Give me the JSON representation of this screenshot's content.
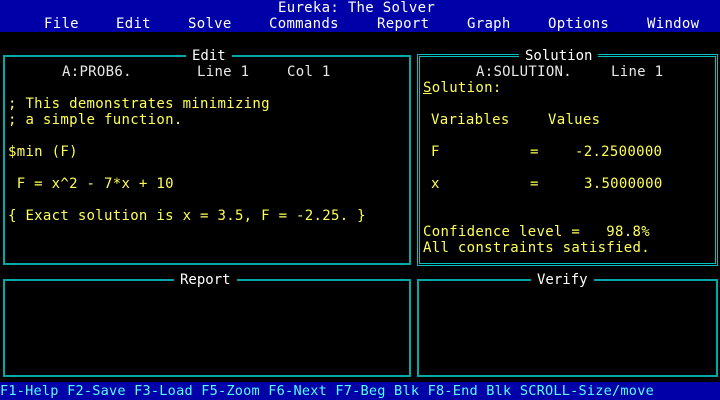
{
  "app_title": "Eureka: The Solver",
  "menu": [
    "File",
    "Edit",
    "Solve",
    "Commands",
    "Report",
    "Graph",
    "Options",
    "Window"
  ],
  "edit_pane": {
    "title": "Edit",
    "file": "A:PROB6.",
    "line": "Line 1",
    "col": "Col 1",
    "lines": [
      "; This demonstrates minimizing",
      "; a simple function.",
      "$min (F)",
      " F = x^2 - 7*x + 10",
      "{ Exact solution is x = 3.5, F = -2.25. }"
    ]
  },
  "solution_pane": {
    "title": "Solution",
    "file": "A:SOLUTION.",
    "line": "Line 1",
    "heading_hotkey": "S",
    "heading_rest": "olution:",
    "col_variables": "Variables",
    "col_values": "Values",
    "rows": [
      {
        "var": "F",
        "eq": "=",
        "value": "-2.2500000"
      },
      {
        "var": "x",
        "eq": "=",
        "value": "3.5000000"
      }
    ],
    "confidence": "Confidence level =   98.8%",
    "constraints": "All constraints satisfied."
  },
  "report_pane": {
    "title": "Report"
  },
  "verify_pane": {
    "title": "Verify"
  },
  "status_bar": "F1-Help F2-Save F3-Load F5-Zoom F6-Next F7-Beg Blk F8-End Blk SCROLL-Size/move",
  "colors": {
    "menu_bg": "#0000a8",
    "text_yellow": "#ffff55",
    "border_cyan": "#00a8a8"
  }
}
